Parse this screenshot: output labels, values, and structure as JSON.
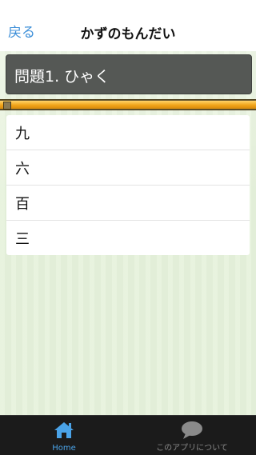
{
  "nav": {
    "back_label": "戻る",
    "title": "かずのもんだい"
  },
  "question": {
    "text": "問題1. ひゃく"
  },
  "progress": {
    "fraction": 1.0
  },
  "choices": [
    {
      "label": "九"
    },
    {
      "label": "六"
    },
    {
      "label": "百"
    },
    {
      "label": "三"
    }
  ],
  "tabbar": {
    "home_label": "Home",
    "home_icon": "house-icon",
    "about_label": "このアプリについて",
    "about_icon": "speech-bubble-icon"
  },
  "colors": {
    "accent": "#3d8fd8",
    "content_bg": "#e6f2db",
    "question_bg": "#555855",
    "progress_fill": "#f1a41a",
    "tabbar_bg": "#1b1b1b"
  }
}
